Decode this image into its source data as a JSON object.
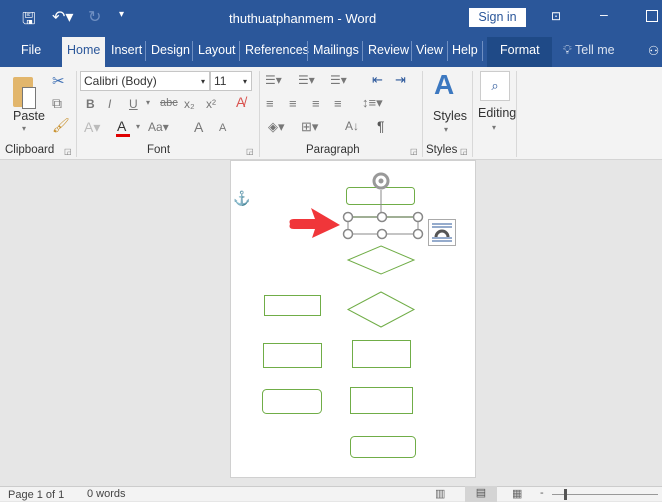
{
  "titlebar": {
    "doc_title": "thuthuatphanmem  -  Word",
    "sign_in": "Sign in"
  },
  "tabs": [
    "File",
    "Home",
    "Insert",
    "Design",
    "Layout",
    "References",
    "Mailings",
    "Review",
    "View",
    "Help",
    "Format"
  ],
  "tell_me": "Tell me",
  "ribbon": {
    "paste": "Paste",
    "font_name": "Calibri (Body)",
    "font_size": "11",
    "styles": "Styles",
    "editing": "Editing",
    "groups": {
      "clipboard": "Clipboard",
      "font": "Font",
      "paragraph": "Paragraph",
      "styles": "Styles"
    },
    "font_buttons": {
      "bold": "B",
      "italic": "I",
      "underline": "U",
      "strike": "abc",
      "sub": "x₂",
      "sup": "x²",
      "case": "Aa",
      "grow": "A",
      "shrink": "A"
    }
  },
  "status": {
    "page": "Page 1 of 1",
    "words": "0 words"
  },
  "colors": {
    "brand": "#2b579a",
    "shape_outline": "#70ad47",
    "arrow": "#f0363a",
    "font_color_bar": "#e00000"
  }
}
